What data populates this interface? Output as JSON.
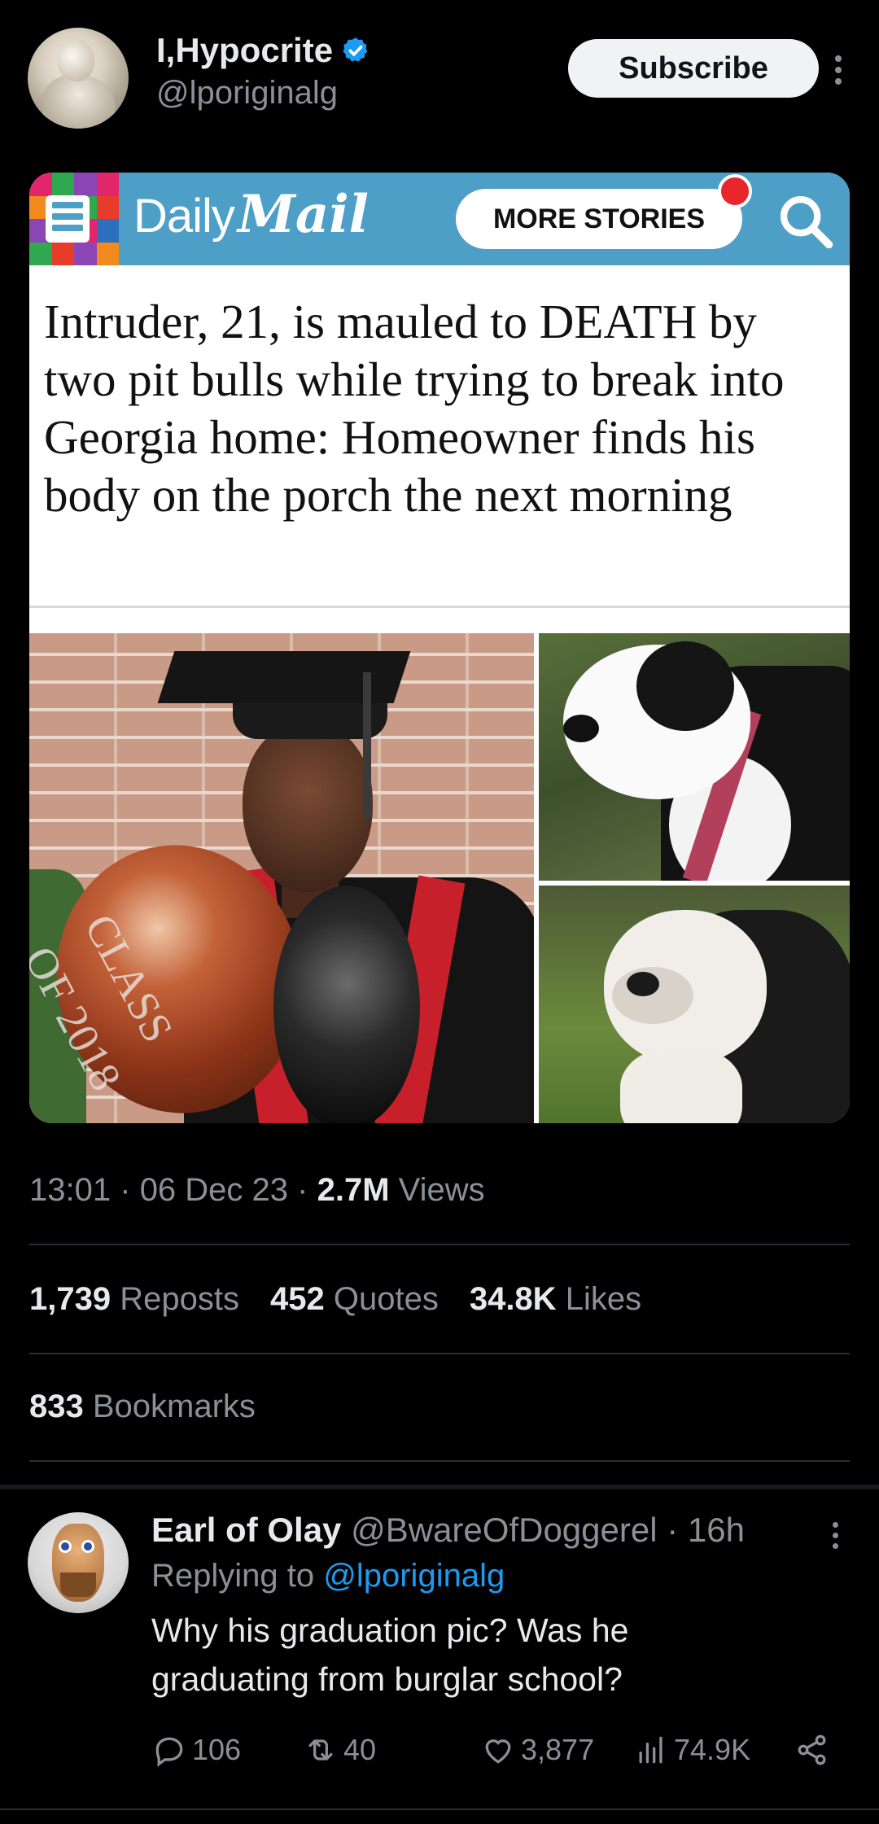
{
  "post": {
    "display_name": "I,Hypocrite",
    "handle": "@lporiginalg",
    "subscribe_label": "Subscribe"
  },
  "media": {
    "brand_daily": "Daily",
    "brand_mail": "Mail",
    "more_stories_label": "MORE STORIES",
    "headline": "Intruder, 21, is mauled to DEATH by two pit bulls while trying to break into Georgia home: Homeowner finds his body on the porch the next morning",
    "balloon_text": "CLASS OF 2018"
  },
  "meta": {
    "time": "13:01",
    "date": "06 Dec 23",
    "views_count": "2.7M",
    "views_label": "Views",
    "separator": "·"
  },
  "stats": {
    "reposts_count": "1,739",
    "reposts_label": "Reposts",
    "quotes_count": "452",
    "quotes_label": "Quotes",
    "likes_count": "34.8K",
    "likes_label": "Likes",
    "bookmarks_count": "833",
    "bookmarks_label": "Bookmarks"
  },
  "reply": {
    "name": "Earl of Olay",
    "handle": "@BwareOfDoggerel",
    "age": "16h",
    "separator": "·",
    "replying_prefix": "Replying to",
    "replying_handle": "@lporiginalg",
    "text": "Why his graduation pic?  Was he graduating from burglar school?",
    "actions": {
      "replies": "106",
      "reposts": "40",
      "likes": "3,877",
      "views": "74.9K"
    }
  },
  "colors": {
    "background": "#000000",
    "accent_link": "#1d9bf0",
    "daily_mail_bar": "#4e9fc7",
    "verified_badge": "#1d9bf0"
  },
  "icons": [
    "verified-icon",
    "more-vertical-icon",
    "menu-icon",
    "search-icon",
    "reply-icon",
    "repost-icon",
    "like-icon",
    "views-icon",
    "share-icon"
  ]
}
